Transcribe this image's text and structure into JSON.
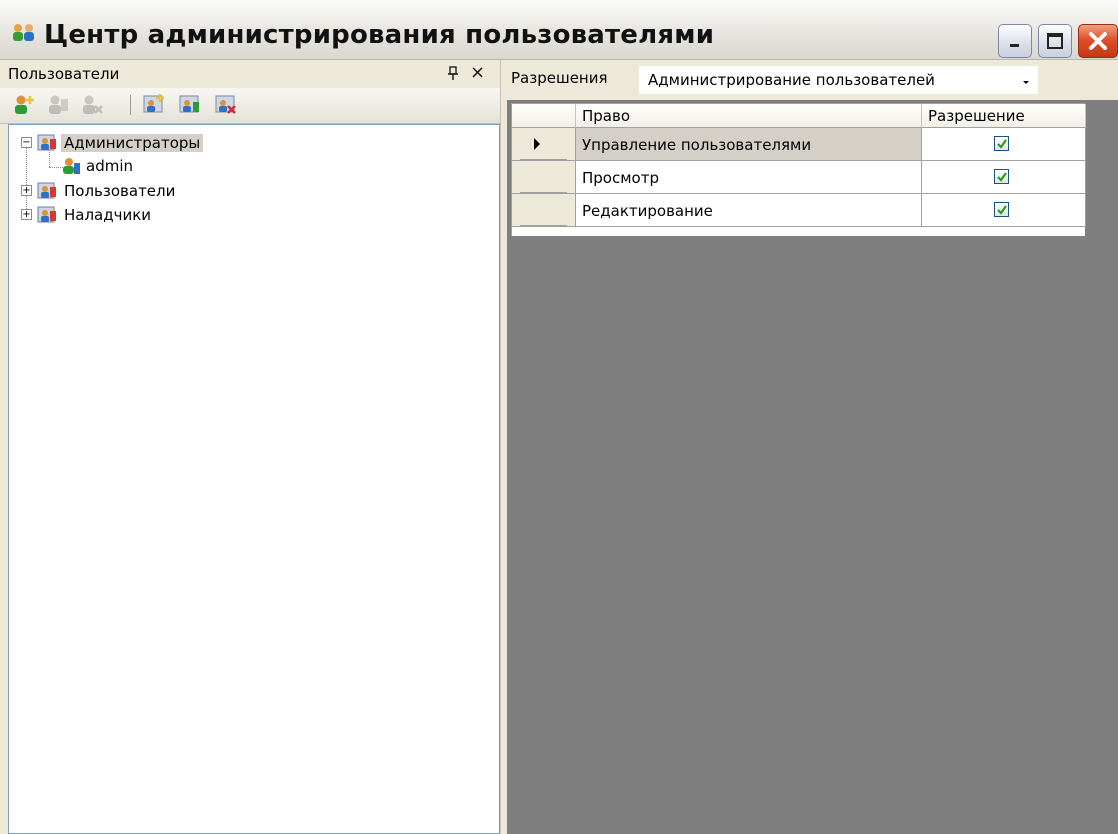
{
  "window": {
    "title": "Центр администрирования пользователями"
  },
  "left_pane": {
    "title": "Пользователи",
    "pin_glyph": "q",
    "toolbar": [
      {
        "name": "add-user-icon",
        "enabled": true
      },
      {
        "name": "edit-user-icon",
        "enabled": false
      },
      {
        "name": "delete-user-icon",
        "enabled": false
      },
      {
        "name": "add-group-icon",
        "enabled": true
      },
      {
        "name": "edit-group-icon",
        "enabled": true
      },
      {
        "name": "delete-group-icon",
        "enabled": true
      }
    ],
    "tree": [
      {
        "label": "Администраторы",
        "expanded": true,
        "selected": true,
        "children": [
          {
            "label": "admin"
          }
        ]
      },
      {
        "label": "Пользователи",
        "expanded": false
      },
      {
        "label": "Наладчики",
        "expanded": false
      }
    ]
  },
  "right_pane": {
    "permissions_label": "Разрешения",
    "module_select": {
      "value": "Администрирование пользователей"
    },
    "grid": {
      "columns": [
        "Право",
        "Разрешение"
      ],
      "rows": [
        {
          "right": "Управление пользователями",
          "allowed": true,
          "current": true
        },
        {
          "right": "Просмотр",
          "allowed": true,
          "current": false
        },
        {
          "right": "Редактирование",
          "allowed": true,
          "current": false
        }
      ]
    }
  },
  "colors": {
    "workspace": "#7f7f7f",
    "chrome": "#ece9d8",
    "selection": "#d4d0c8",
    "check": "#21a121"
  }
}
